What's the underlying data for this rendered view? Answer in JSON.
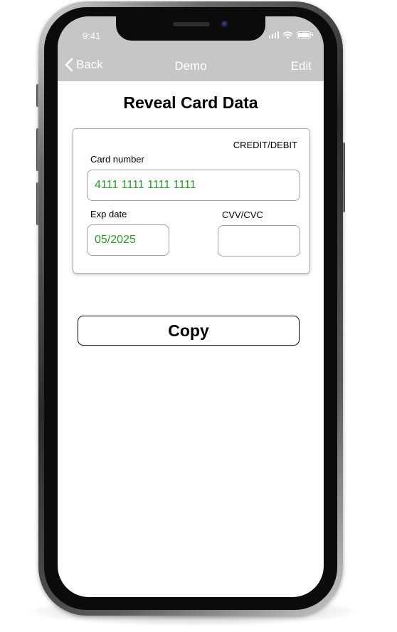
{
  "status_bar": {
    "time": "9:41",
    "icons": [
      "signal-icon",
      "wifi-icon",
      "battery-icon"
    ]
  },
  "nav": {
    "back_label": "Back",
    "back_icon": "chevron-left-icon",
    "title": "Demo",
    "edit_label": "Edit"
  },
  "page": {
    "title": "Reveal Card Data"
  },
  "card": {
    "type": "CREDIT/DEBIT",
    "card_number_label": "Card number",
    "card_number_value": "4111 1111 1111 1111",
    "exp_label": "Exp date",
    "exp_value": "05/2025",
    "cvv_label": "CVV/CVC",
    "cvv_value": ""
  },
  "actions": {
    "copy_label": "Copy"
  },
  "colors": {
    "nav_background": "#c6c6c6",
    "revealed_value": "#2e9a2e"
  }
}
